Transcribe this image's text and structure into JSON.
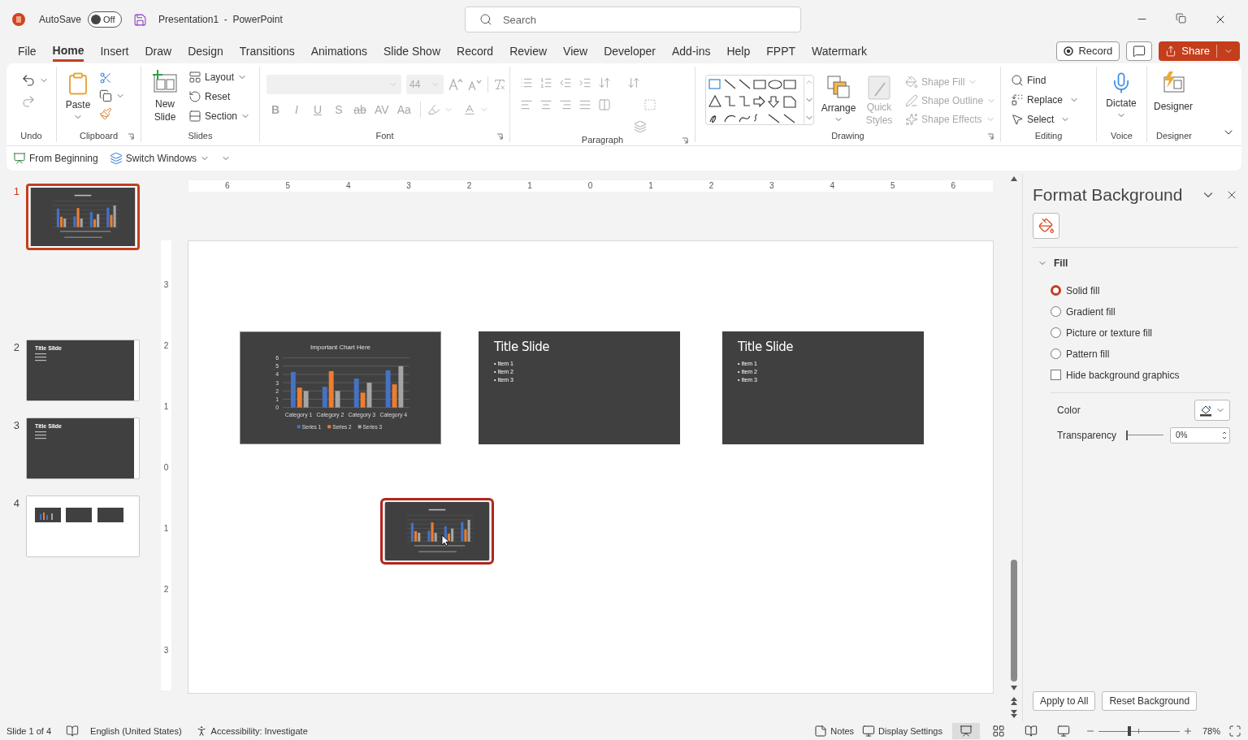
{
  "title_bar": {
    "autosave_label": "AutoSave",
    "autosave_state": "Off",
    "autosave_on": false,
    "document_title": "Presentation1  -  PowerPoint",
    "search_placeholder": "Search"
  },
  "menu_tabs": [
    {
      "label": "File",
      "selected": false
    },
    {
      "label": "Home",
      "selected": true
    },
    {
      "label": "Insert",
      "selected": false
    },
    {
      "label": "Draw",
      "selected": false
    },
    {
      "label": "Design",
      "selected": false
    },
    {
      "label": "Transitions",
      "selected": false
    },
    {
      "label": "Animations",
      "selected": false
    },
    {
      "label": "Slide Show",
      "selected": false
    },
    {
      "label": "Record",
      "selected": false
    },
    {
      "label": "Review",
      "selected": false
    },
    {
      "label": "View",
      "selected": false
    },
    {
      "label": "Developer",
      "selected": false
    },
    {
      "label": "Add-ins",
      "selected": false
    },
    {
      "label": "Help",
      "selected": false
    },
    {
      "label": "FPPT",
      "selected": false
    },
    {
      "label": "Watermark",
      "selected": false
    }
  ],
  "header_buttons": {
    "record": "Record",
    "share": "Share"
  },
  "ribbon": {
    "undo": {
      "label": "Undo"
    },
    "clipboard": {
      "label": "Clipboard",
      "paste": "Paste"
    },
    "slides": {
      "label": "Slides",
      "new_slide": "New Slide",
      "items": [
        "Layout",
        "Reset",
        "Section"
      ]
    },
    "font": {
      "label": "Font",
      "size": "44",
      "disabled": true,
      "buttons": [
        "B",
        "I",
        "U",
        "S",
        "ab",
        "AV",
        "Aa"
      ]
    },
    "paragraph": {
      "label": "Paragraph",
      "disabled": true
    },
    "drawing": {
      "label": "Drawing",
      "arrange": "Arrange",
      "quick_styles": "Quick Styles",
      "quick_styles_disabled": true,
      "shape_items": [
        "Shape Fill",
        "Shape Outline",
        "Shape Effects"
      ],
      "shape_items_disabled": true
    },
    "editing": {
      "label": "Editing",
      "items": [
        "Find",
        "Replace",
        "Select"
      ]
    },
    "voice": {
      "label": "Voice",
      "dictate": "Dictate"
    },
    "designer": {
      "label": "Designer",
      "button": "Designer"
    }
  },
  "quick_access": [
    "From Beginning",
    "Switch Windows"
  ],
  "thumbnails": [
    {
      "number": "1",
      "selected": true,
      "kind": "chart"
    },
    {
      "number": "2",
      "selected": false,
      "kind": "title",
      "title": "Title Slide"
    },
    {
      "number": "3",
      "selected": false,
      "kind": "title",
      "title": "Title Slide"
    },
    {
      "number": "4",
      "selected": false,
      "kind": "overview"
    }
  ],
  "horizontal_ruler": [
    "6",
    "5",
    "4",
    "3",
    "2",
    "1",
    "0",
    "1",
    "2",
    "3",
    "4",
    "5",
    "6"
  ],
  "vertical_ruler": [
    "3",
    "2",
    "1",
    "0",
    "1",
    "2",
    "3"
  ],
  "canvas": {
    "chart_slide": {
      "chart_data": {
        "type": "bar",
        "title": "Important Chart Here",
        "categories": [
          "Category 1",
          "Category 2",
          "Category 3",
          "Category 4"
        ],
        "series": [
          {
            "name": "Series 1",
            "color": "#4472c4",
            "values": [
              4.3,
              2.5,
              3.5,
              4.5
            ]
          },
          {
            "name": "Series 2",
            "color": "#ed7d31",
            "values": [
              2.4,
              4.4,
              1.8,
              2.8
            ]
          },
          {
            "name": "Series 3",
            "color": "#a5a5a5",
            "values": [
              2,
              2,
              3,
              5
            ]
          }
        ],
        "ylim": [
          0,
          6
        ],
        "yticks": [
          0,
          1,
          2,
          3,
          4,
          5,
          6
        ],
        "grid": true,
        "legend": true
      }
    },
    "title_slides": [
      {
        "title": "Title Slide",
        "items": [
          "• Item 1",
          "• Item 2",
          "• Item 3"
        ]
      },
      {
        "title": "Title Slide",
        "items": [
          "• Item 1",
          "• Item 2",
          "• Item 3"
        ]
      }
    ],
    "slide_copy": {
      "selected": true
    }
  },
  "format_panel": {
    "title": "Format Background",
    "section": {
      "label": "Fill",
      "expanded": true
    },
    "fill_options": [
      {
        "label": "Solid fill",
        "selected": true
      },
      {
        "label": "Gradient fill",
        "selected": false
      },
      {
        "label": "Picture or texture fill",
        "selected": false
      },
      {
        "label": "Pattern fill",
        "selected": false
      }
    ],
    "hide_graphics": {
      "label": "Hide background graphics",
      "checked": false
    },
    "color_label": "Color",
    "transparency": {
      "label": "Transparency",
      "level": 0,
      "value": "0%"
    },
    "buttons": [
      "Apply to All",
      "Reset Background"
    ]
  },
  "status_bar": {
    "slide_info": "Slide 1 of 4",
    "language": "English (United States)",
    "accessibility": "Accessibility: Investigate",
    "notes": "Notes",
    "display_settings": "Display Settings",
    "views": [
      {
        "kind": "normal",
        "selected": true
      },
      {
        "kind": "sorter",
        "selected": false
      },
      {
        "kind": "reading",
        "selected": false
      },
      {
        "kind": "slideshow",
        "selected": false
      }
    ],
    "zoom": {
      "level": 0.38,
      "value": "78%"
    }
  }
}
